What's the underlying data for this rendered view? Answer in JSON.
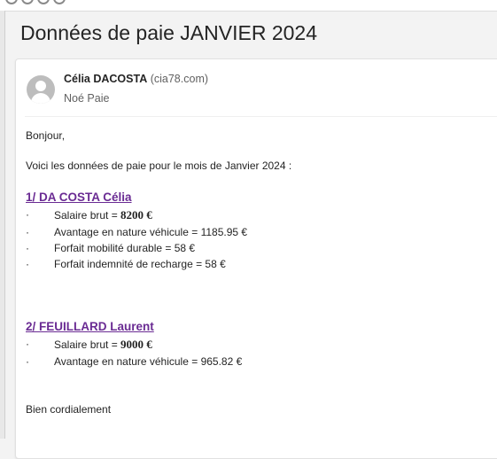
{
  "subject": "Données de paie JANVIER 2024",
  "sender": {
    "name": "Célia DACOSTA",
    "domain": "(cia78.com)",
    "recipient": "Noé Paie"
  },
  "body": {
    "greeting": "Bonjour,",
    "intro": "Voici les données de paie pour le mois de Janvier 2024 :",
    "bullet_char": "·",
    "sections": [
      {
        "title": "1/ DA COSTA Célia",
        "items": [
          {
            "prefix": "Salaire brut = ",
            "value": "8200 €",
            "bold": true
          },
          {
            "prefix": "Avantage en nature véhicule = 1185.95 €",
            "value": "",
            "bold": false
          },
          {
            "prefix": "Forfait mobilité durable = 58 €",
            "value": "",
            "bold": false
          },
          {
            "prefix": "Forfait indemnité de recharge = 58 €",
            "value": "",
            "bold": false
          }
        ]
      },
      {
        "title": "2/ FEUILLARD Laurent",
        "items": [
          {
            "prefix": "Salaire brut = ",
            "value": "9000 €",
            "bold": true
          },
          {
            "prefix": "Avantage en nature véhicule = 965.82 €",
            "value": "",
            "bold": false
          }
        ]
      }
    ],
    "closing": "Bien cordialement"
  }
}
